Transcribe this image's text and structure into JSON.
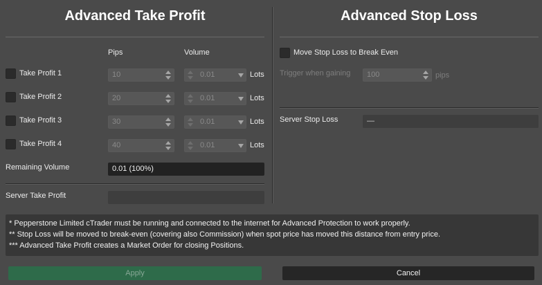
{
  "take_profit": {
    "title": "Advanced Take Profit",
    "col_pips": "Pips",
    "col_volume": "Volume",
    "rows": [
      {
        "label": "Take Profit 1",
        "pips": "10",
        "volume": "0.01",
        "unit": "Lots"
      },
      {
        "label": "Take Profit 2",
        "pips": "20",
        "volume": "0.01",
        "unit": "Lots"
      },
      {
        "label": "Take Profit 3",
        "pips": "30",
        "volume": "0.01",
        "unit": "Lots"
      },
      {
        "label": "Take Profit 4",
        "pips": "40",
        "volume": "0.01",
        "unit": "Lots"
      }
    ],
    "remaining_label": "Remaining Volume",
    "remaining_value": "0.01 (100%)",
    "server_label": "Server Take Profit",
    "server_value": ""
  },
  "stop_loss": {
    "title": "Advanced Stop Loss",
    "break_even_label": "Move Stop Loss to Break Even",
    "trigger_label": "Trigger when gaining",
    "trigger_value": "100",
    "trigger_unit": "pips",
    "server_label": "Server Stop Loss",
    "server_value": "—"
  },
  "notes": [
    "* Pepperstone Limited cTrader must be running and connected to the internet for Advanced Protection to work properly.",
    "** Stop Loss will be moved to break-even (covering also Commission) when spot price has moved this distance from entry price.",
    "*** Advanced Take Profit creates a Market Order for closing Positions."
  ],
  "buttons": {
    "apply": "Apply",
    "cancel": "Cancel"
  },
  "colors": {
    "background": "#4a4a4a",
    "apply_button": "#2e6b4a",
    "cancel_button": "#262626"
  },
  "icons": {
    "spinner": "spinner-arrows-icon",
    "dropdown": "chevron-down-icon"
  }
}
